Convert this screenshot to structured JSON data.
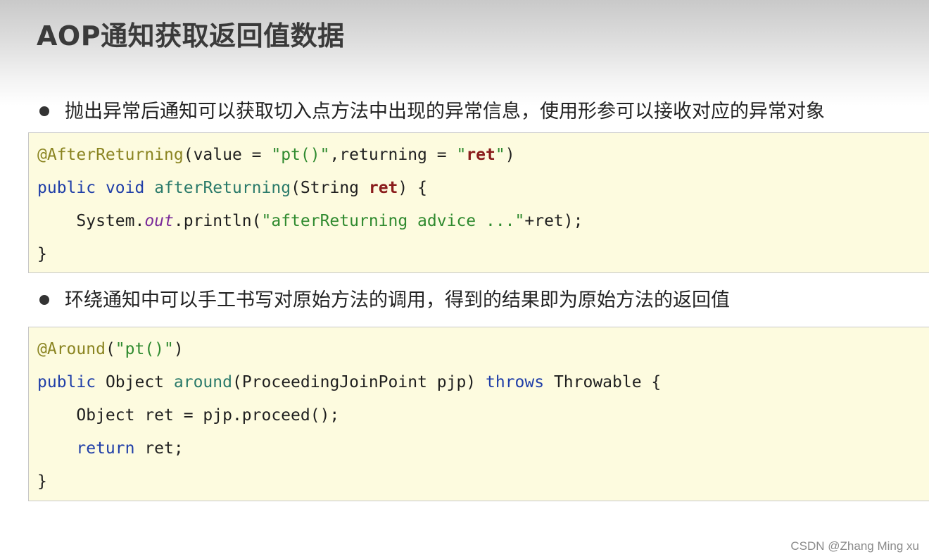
{
  "title": "AOP通知获取返回值数据",
  "bullets": [
    "抛出异常后通知可以获取切入点方法中出现的异常信息，使用形参可以接收对应的异常对象",
    "环绕通知中可以手工书写对原始方法的调用，得到的结果即为原始方法的返回值"
  ],
  "code1": {
    "l1_ann": "@AfterReturning",
    "l1_a": "(value = ",
    "l1_s1": "\"pt()\"",
    "l1_b": ",returning = ",
    "l1_q1": "\"",
    "l1_var": "ret",
    "l1_q2": "\"",
    "l1_c": ")",
    "l2_kw1": "public",
    "l2_kw2": "void",
    "l2_fn": "afterReturning",
    "l2_a": "(String ",
    "l2_var": "ret",
    "l2_b": ") {",
    "l3_a": "    System.",
    "l3_fld": "out",
    "l3_b": ".println(",
    "l3_s": "\"afterReturning advice ...\"",
    "l3_c": "+ret);",
    "l4": "}"
  },
  "code2": {
    "l1_ann": "@Around",
    "l1_a": "(",
    "l1_s": "\"pt()\"",
    "l1_b": ")",
    "l2_kw": "public",
    "l2_a": " Object ",
    "l2_fn": "around",
    "l2_b": "(ProceedingJoinPoint pjp) ",
    "l2_kw2": "throws",
    "l2_c": " Throwable {",
    "l3": "    Object ret = pjp.proceed();",
    "l4_ind": "    ",
    "l4_kw": "return",
    "l4_a": " ret;",
    "l5": "}"
  },
  "watermark": "CSDN @Zhang Ming xu",
  "colors": {
    "code_background": "#fdfbdf",
    "keyword": "#1f3ea8",
    "annotation": "#8a8421",
    "string": "#2f8a2f"
  }
}
